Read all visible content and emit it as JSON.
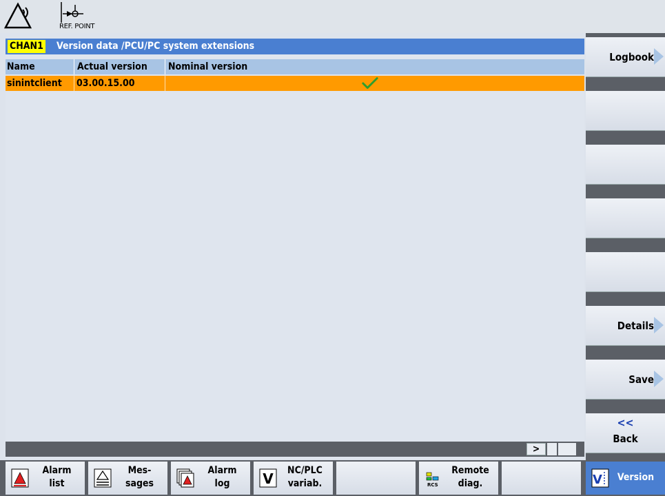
{
  "status": {
    "refpoint_label": "REF. POINT"
  },
  "panel": {
    "channel": "CHAN1",
    "title": "Version data  /PCU/PC system extensions",
    "columns": [
      "Name",
      "Actual version",
      "Nominal version"
    ],
    "rows": [
      {
        "name": "sinintclient",
        "actual": "03.00.15.00",
        "nominal_status": "check-icon"
      }
    ],
    "scroll_right_label": ">"
  },
  "vertical_softkeys": [
    {
      "label": "Logbook",
      "arrow": true
    },
    {
      "label": "",
      "arrow": false
    },
    {
      "label": "",
      "arrow": false
    },
    {
      "label": "",
      "arrow": false
    },
    {
      "label": "",
      "arrow": false
    },
    {
      "label": "Details",
      "arrow": true
    },
    {
      "label": "Save",
      "arrow": true
    }
  ],
  "back_key": {
    "chevron": "<<",
    "label": "Back"
  },
  "horizontal_softkeys": [
    {
      "label_line1": "Alarm",
      "label_line2": "list",
      "icon": "alarm-list-icon"
    },
    {
      "label_line1": "Mes-",
      "label_line2": "sages",
      "icon": "messages-icon"
    },
    {
      "label_line1": "Alarm",
      "label_line2": "log",
      "icon": "alarm-log-icon"
    },
    {
      "label_line1": "NC/PLC",
      "label_line2": "variab.",
      "icon": "variable-icon"
    },
    {
      "label_line1": "",
      "label_line2": "",
      "icon": ""
    },
    {
      "label_line1": "Remote",
      "label_line2": "diag.",
      "icon": "remote-diag-icon"
    },
    {
      "label_line1": "",
      "label_line2": "",
      "icon": ""
    },
    {
      "label_line1": "Version",
      "label_line2": "",
      "icon": "version-icon"
    }
  ],
  "colors": {
    "header_blue": "#4a7fd1",
    "column_header": "#a8c4e4",
    "selected_row": "#ff9a00",
    "channel_badge": "#ffff00",
    "check_green": "#2e9e2e"
  }
}
